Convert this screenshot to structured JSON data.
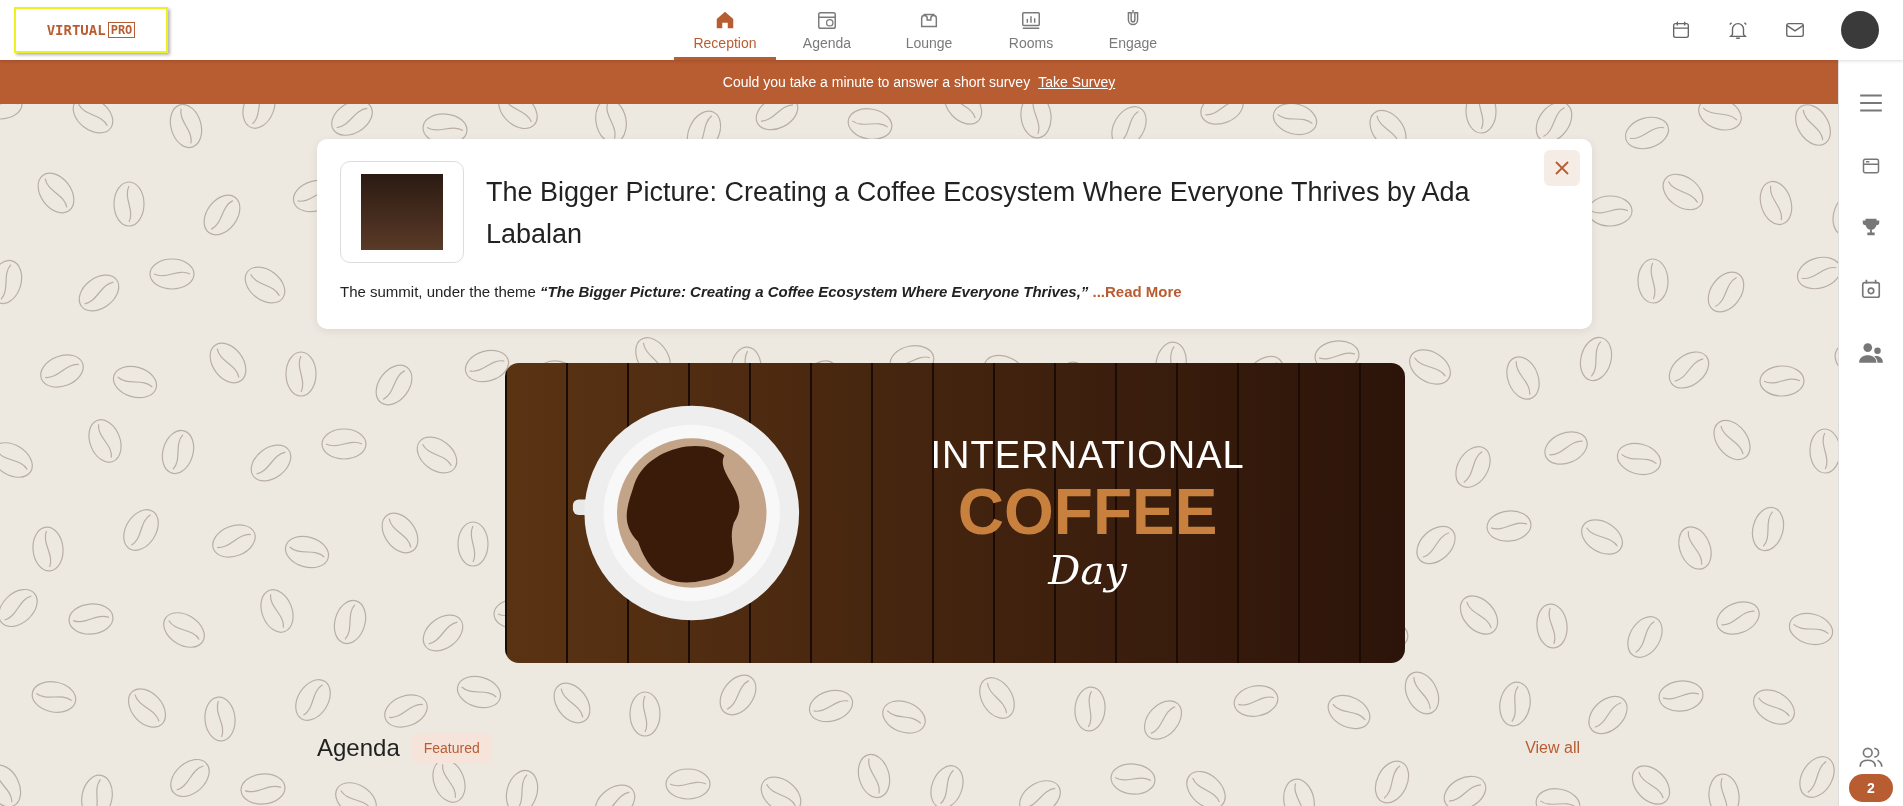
{
  "logo": {
    "word": "VIRTUAL",
    "suffix": "PRO"
  },
  "nav": [
    {
      "label": "Reception",
      "selected": true
    },
    {
      "label": "Agenda",
      "selected": false
    },
    {
      "label": "Lounge",
      "selected": false
    },
    {
      "label": "Rooms",
      "selected": false
    },
    {
      "label": "Engage",
      "selected": false
    }
  ],
  "survey_bar": {
    "text": "Could you take a minute to answer a short survey",
    "link": "Take Survey"
  },
  "announcement": {
    "title": "The Bigger Picture: Creating a Coffee Ecosystem Where Everyone Thrives by Ada Labalan",
    "description": "The summit, under the theme **“The Bigger Picture: Creating a Coffee Ecosystem Where Everyone Thrives,”**",
    "read_more": "...Read More"
  },
  "banner": {
    "line_1": "INTERNATIONAL",
    "line_2": "COFFEE",
    "line_3": "Day"
  },
  "agenda": {
    "title": "Agenda",
    "badge": "Featured",
    "view_all": "View all"
  },
  "sidebar": {
    "count": "2"
  }
}
